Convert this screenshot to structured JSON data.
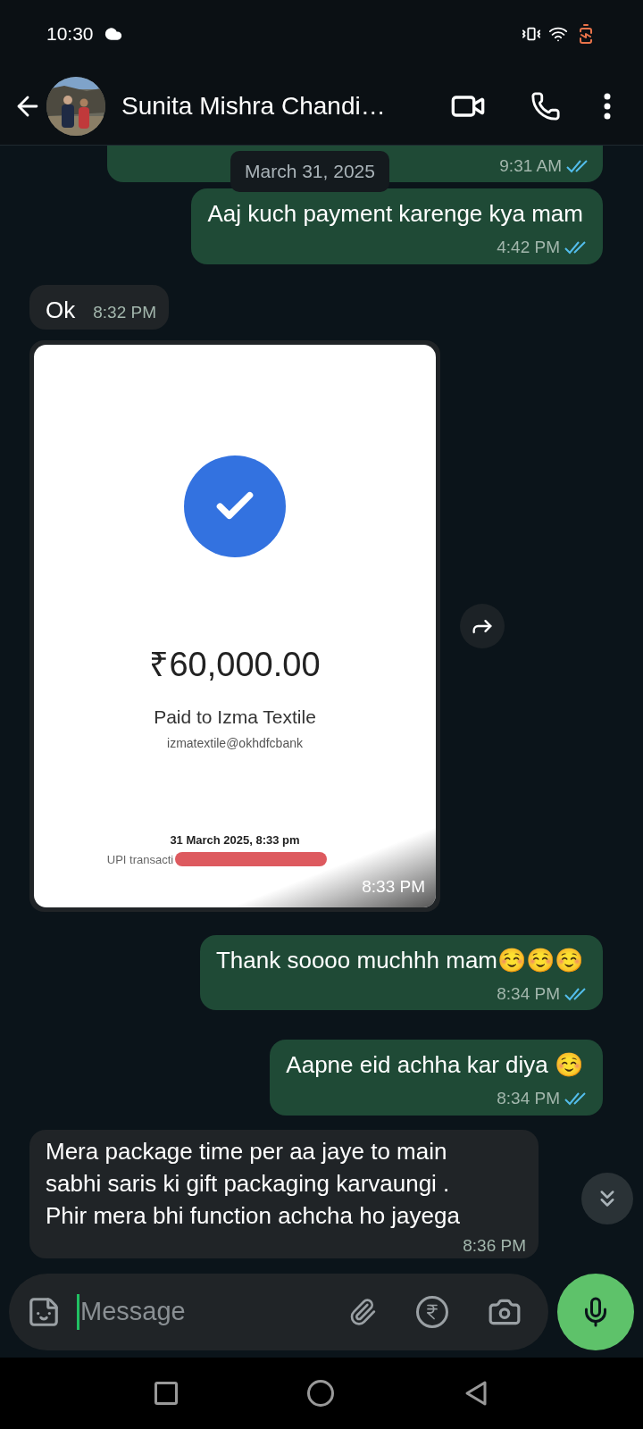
{
  "status_bar": {
    "time": "10:30"
  },
  "header": {
    "contact_name": "Sunita Mishra Chandi…"
  },
  "date_chip": "March 31, 2025",
  "messages": [
    {
      "kind": "cut",
      "outgoing": true,
      "time": "9:31 AM",
      "read": true
    },
    {
      "kind": "text",
      "outgoing": true,
      "text": "Aaj kuch payment karenge kya mam",
      "time": "4:42 PM",
      "read": true
    },
    {
      "kind": "text",
      "outgoing": false,
      "text": "Ok",
      "time": "8:32 PM"
    },
    {
      "outgoing": false,
      "time": "8:33 PM",
      "receipt": {
        "amount": "₹60,000.00",
        "payee": "Paid to Izma Textile",
        "upi_id": "izmatextile@okhdfcbank",
        "date": "31 March 2025, 8:33 pm",
        "transaction": "UPI transacti"
      }
    },
    {
      "kind": "text",
      "outgoing": true,
      "text": "Thank soooo muchhh mam☺️☺️☺️",
      "time": "8:34 PM",
      "read": true
    },
    {
      "kind": "text",
      "outgoing": true,
      "text": "Aapne eid achha kar diya ☺️",
      "time": "8:34 PM",
      "read": true
    },
    {
      "kind": "text",
      "outgoing": false,
      "text": "Mera package time per aa jaye to main sabhi saris ki gift packaging karvaungi . Phir mera bhi function achcha ho jayega",
      "time": "8:36 PM"
    }
  ],
  "composer": {
    "placeholder": "Message"
  }
}
